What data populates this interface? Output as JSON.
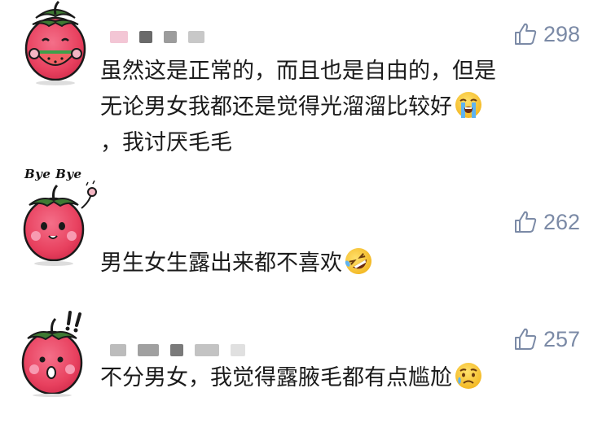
{
  "comments": [
    {
      "likes": "298",
      "lines": [
        "虽然这是正常的，而且也是自由的，但是",
        "无论男女我都还是觉得光溜溜比较好",
        "，我讨厌毛毛"
      ],
      "emoji": "loudly-crying-face",
      "avatar": "strawberry-eating-watermelon"
    },
    {
      "likes": "262",
      "lines": [
        "男生女生露出来都不喜欢"
      ],
      "emoji": "rolling-on-floor-laughing-face",
      "avatar": "strawberry-waving",
      "avatar_caption": "Bye Bye"
    },
    {
      "likes": "257",
      "lines": [
        "不分男女，我觉得露腋毛都有点尴尬"
      ],
      "emoji": "sad-but-relieved-face",
      "avatar": "strawberry-surprised"
    }
  ],
  "colors": {
    "like_gray": "#7b8aa6",
    "text": "#1b1b1b",
    "strawberry_red": "#e8415f",
    "leaf_green": "#3f7a33",
    "emoji_yellow": "#f7c531"
  }
}
